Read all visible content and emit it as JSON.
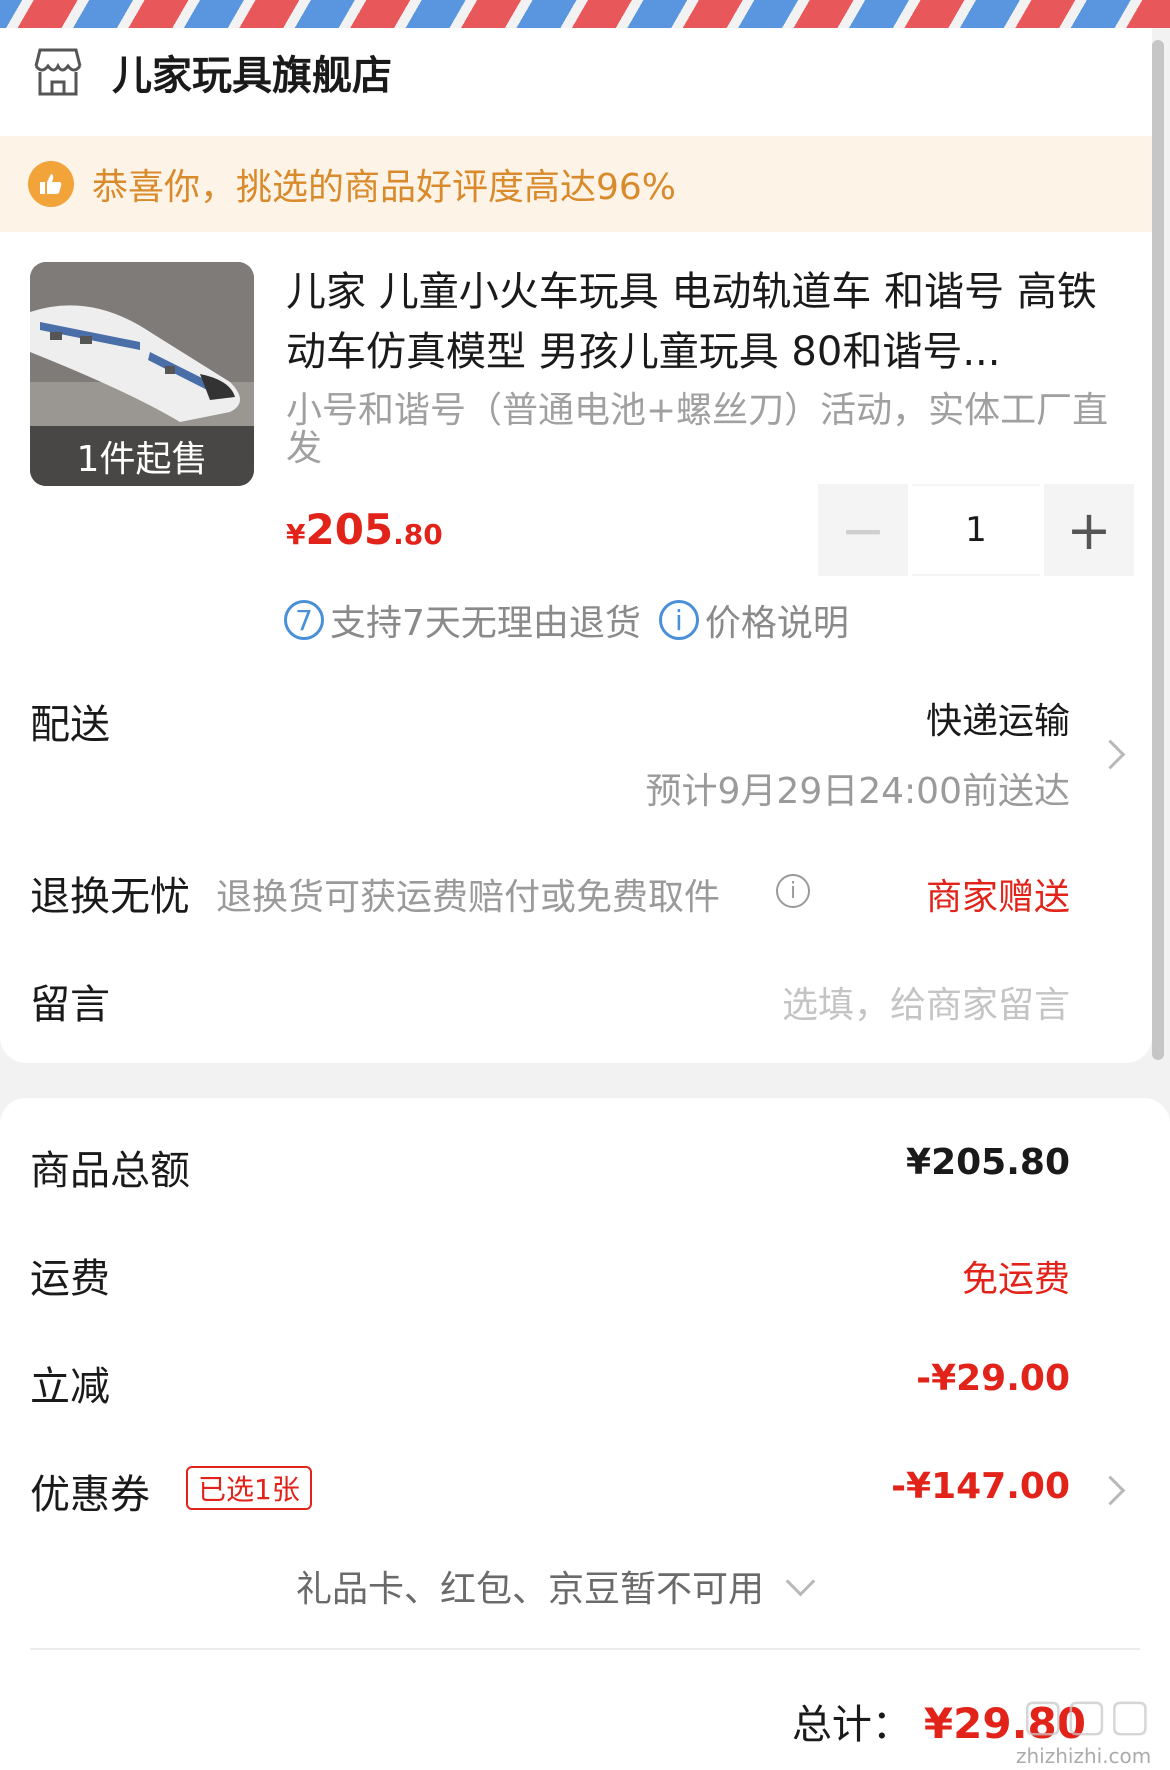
{
  "store": {
    "name": "儿家玩具旗舰店",
    "icon": "store-icon"
  },
  "banner": {
    "text": "恭喜你，挑选的商品好评度高达96%",
    "icon": "thumbs-up-icon"
  },
  "product": {
    "title": "儿家 儿童小火车玩具 电动轨道车 和谐号 高铁动车仿真模型 男孩儿童玩具 80和谐号...",
    "spec": "小号和谐号（普通电池+螺丝刀）活动，实体工厂直发",
    "min_order": "1件起售",
    "price_currency": "¥",
    "price_int": "205",
    "price_dec": ".80",
    "quantity": "1",
    "minus_label": "−",
    "plus_label": "+",
    "service_return_icon": "7",
    "service_return_text": "支持7天无理由退货",
    "service_price_icon": "i",
    "service_price_text": "价格说明"
  },
  "delivery": {
    "label": "配送",
    "method": "快递运输",
    "eta": "预计9月29日24:00前送达"
  },
  "return_worry": {
    "label": "退换无忧",
    "desc": "退换货可获运费赔付或免费取件",
    "info_icon": "i",
    "value": "商家赠送"
  },
  "message": {
    "label": "留言",
    "placeholder": "选填，给商家留言"
  },
  "summary": {
    "goods_total_label": "商品总额",
    "goods_total_value": "¥205.80",
    "shipping_label": "运费",
    "shipping_value": "免运费",
    "discount_label": "立减",
    "discount_value": "-¥29.00",
    "coupon_label": "优惠券",
    "coupon_tag": "已选1张",
    "coupon_value": "-¥147.00",
    "unavailable_text": "礼品卡、红包、京豆暂不可用",
    "total_label": "总计：",
    "total_value": "¥29.80"
  },
  "watermark": "zhizhizhi.com",
  "colors": {
    "accent_red": "#e2231a",
    "banner_bg": "#fdf3e7",
    "banner_text": "#d98a2b",
    "info_blue": "#4a90d9"
  }
}
